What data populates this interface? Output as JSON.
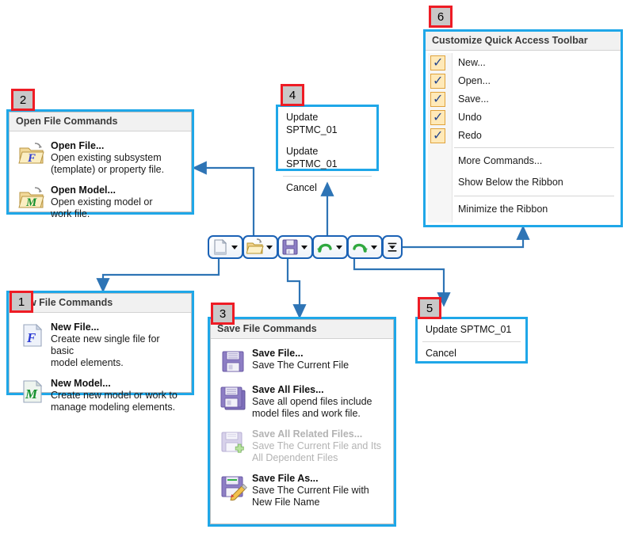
{
  "callouts": [
    {
      "n": "1"
    },
    {
      "n": "2"
    },
    {
      "n": "3"
    },
    {
      "n": "4"
    },
    {
      "n": "5"
    },
    {
      "n": "6"
    }
  ],
  "toolbar": {
    "name": "quick-access-toolbar",
    "buttons": [
      {
        "icon": "new-file-icon",
        "label": "New",
        "has_caret": true
      },
      {
        "icon": "open-folder-icon",
        "label": "Open",
        "has_caret": true
      },
      {
        "icon": "save-floppy-icon",
        "label": "Save",
        "has_caret": true
      },
      {
        "icon": "undo-arrow-icon",
        "label": "Undo",
        "has_caret": true
      },
      {
        "icon": "redo-arrow-icon",
        "label": "Redo",
        "has_caret": true
      },
      {
        "icon": "customize-qat-icon",
        "label": "Customize Quick Access Toolbar",
        "has_caret": false
      }
    ]
  },
  "panel_new": {
    "title": "New File Commands",
    "items": [
      {
        "icon": "new-file-f-icon",
        "title": "New File...",
        "desc_lines": [
          "Create new single file for basic",
          "model elements."
        ],
        "disabled": false
      },
      {
        "icon": "new-model-m-icon",
        "title": "New Model...",
        "desc_lines": [
          "Create new model or work to",
          "manage modeling elements."
        ],
        "disabled": false
      }
    ]
  },
  "panel_open": {
    "title": "Open File Commands",
    "items": [
      {
        "icon": "open-folder-f-icon",
        "title": "Open File...",
        "desc_lines": [
          "Open existing subsystem",
          "(template) or property file."
        ],
        "disabled": false
      },
      {
        "icon": "open-folder-m-icon",
        "title": "Open Model...",
        "desc_lines": [
          "Open existing model or",
          "work file."
        ],
        "disabled": false
      }
    ]
  },
  "panel_save": {
    "title": "Save File Commands",
    "items": [
      {
        "icon": "save-floppy-icon",
        "title": "Save File...",
        "desc_lines": [
          "Save The Current File"
        ],
        "disabled": false
      },
      {
        "icon": "save-all-floppy-icon",
        "title": "Save All Files...",
        "desc_lines": [
          "Save all opend files include",
          "model files and work file."
        ],
        "disabled": false
      },
      {
        "icon": "save-all-related-floppy-icon",
        "title": "Save All Related Files...",
        "desc_lines": [
          "Save The Current File and Its",
          "All Dependent Files"
        ],
        "disabled": true
      },
      {
        "icon": "save-as-floppy-icon",
        "title": "Save File As...",
        "desc_lines": [
          "Save The Current File with",
          "New File Name"
        ],
        "disabled": false
      }
    ]
  },
  "panel_undo": {
    "items": [
      "Update SPTMC_01",
      "Update SPTMC_01"
    ],
    "cancel": "Cancel"
  },
  "panel_redo": {
    "items": [
      "Update SPTMC_01"
    ],
    "cancel": "Cancel"
  },
  "panel_customize": {
    "title": "Customize Quick Access Toolbar",
    "checked_items": [
      {
        "label": "New...",
        "checked": true
      },
      {
        "label": "Open...",
        "checked": true
      },
      {
        "label": "Save...",
        "checked": true
      },
      {
        "label": "Undo",
        "checked": true
      },
      {
        "label": "Redo",
        "checked": true
      }
    ],
    "plain_items_group1": [
      "More Commands...",
      "Show Below the Ribbon"
    ],
    "plain_items_group2": [
      "Minimize the Ribbon"
    ]
  },
  "colors": {
    "panel_border": "#1fa7e8",
    "callout_border": "#ee1c25",
    "callout_fill": "#c8c8c8",
    "connector": "#2e74b5",
    "toolbar_border": "#1b62b5",
    "checkbox_border": "#e0a33c",
    "checkbox_fill": "#ffe9b8",
    "check_mark": "#26478d"
  }
}
